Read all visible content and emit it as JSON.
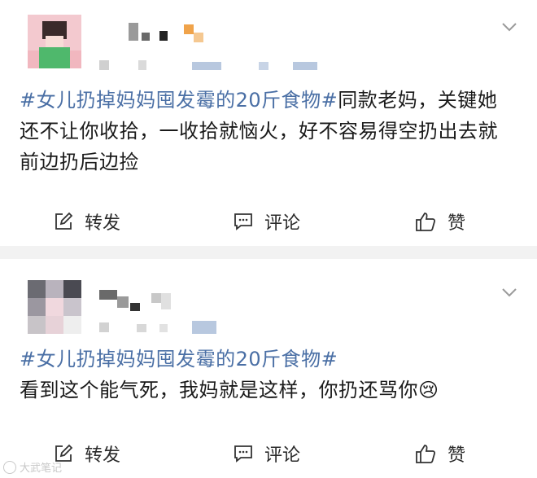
{
  "posts": [
    {
      "topic": "#女儿扔掉妈妈囤发霉的20斤食物#",
      "body": "同款老妈，关键她还不让你收拾，一收拾就恼火，好不容易得空扔出去就前边扔后边捡",
      "emoji": "",
      "actions": {
        "repost": "转发",
        "comment": "评论",
        "like": "赞"
      }
    },
    {
      "topic": "#女儿扔掉妈妈囤发霉的20斤食物#",
      "body": "看到这个能气死，我妈就是这样，你扔还骂你",
      "emoji": "😢",
      "actions": {
        "repost": "转发",
        "comment": "评论",
        "like": "赞"
      }
    }
  ],
  "icons": {
    "repost": "repost-edit-icon",
    "comment": "comment-bubble-icon",
    "like": "thumbs-up-icon",
    "menu": "chevron-down-icon"
  },
  "colors": {
    "topic": "#4a6fa5",
    "separator": "#f2f2f2",
    "text": "#1a1a1a"
  },
  "watermark": {
    "text": "大武笔记"
  }
}
